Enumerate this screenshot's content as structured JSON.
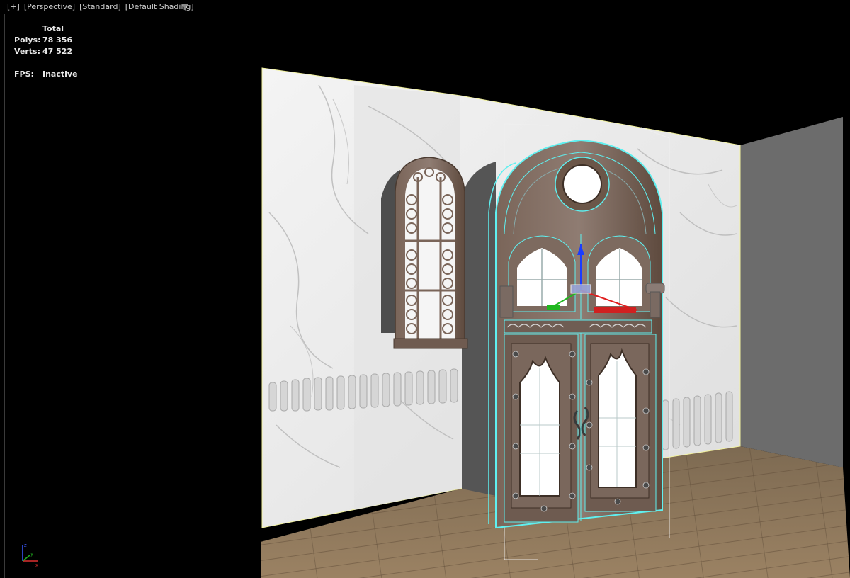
{
  "viewport": {
    "label": {
      "plus": "[+]",
      "view": "[Perspective]",
      "style": "[Standard]",
      "shading": "[Default Shading]"
    },
    "filter_icon": "filter-funnel-icon"
  },
  "stats": {
    "header": "Total",
    "polys_label": "Polys:",
    "polys_value": "78 356",
    "verts_label": "Verts:",
    "verts_value": "47 522",
    "fps_label": "FPS:",
    "fps_value": "Inactive"
  },
  "gizmo": {
    "z_label": "z",
    "x_label": "x",
    "y_label": "y"
  },
  "colors": {
    "selection": "#5ff0f0",
    "wall": "#e9e9e9",
    "floor": "#8a7255",
    "frame": "#6b5648",
    "side_wall": "#6c6c6c"
  }
}
